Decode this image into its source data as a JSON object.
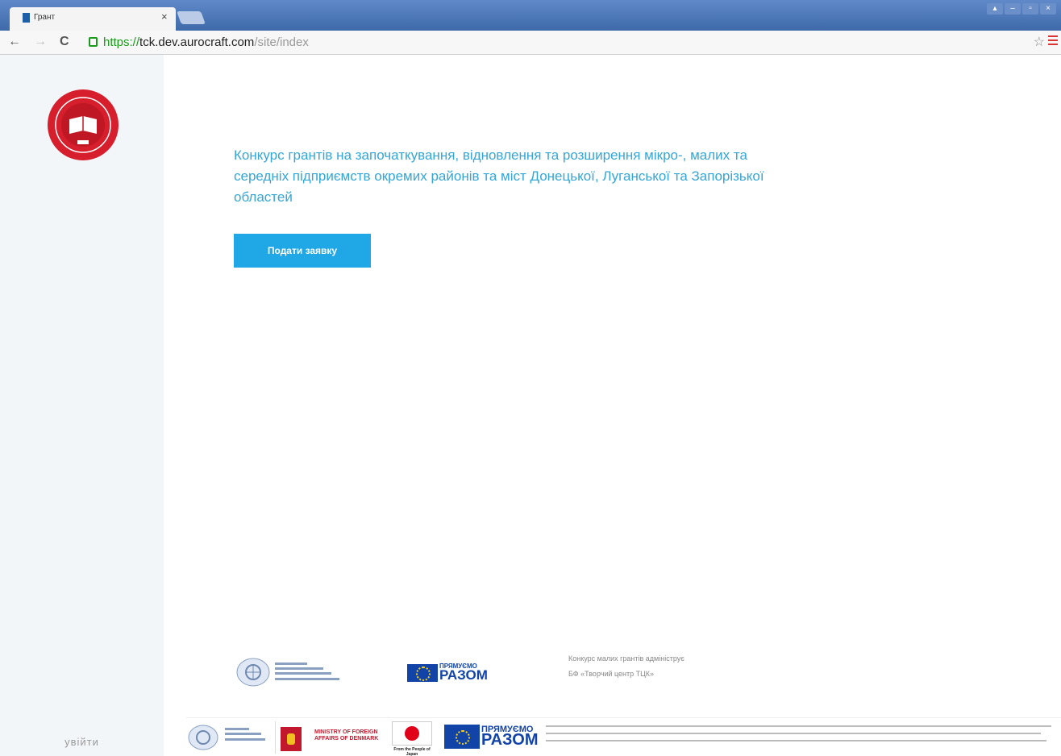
{
  "browser": {
    "tab_title": "Грант",
    "url_scheme": "https://",
    "url_host": "tck.dev.aurocraft.com",
    "url_path": "/site/index"
  },
  "sidebar": {
    "login_label": "увійти"
  },
  "main": {
    "headline": "Конкурс грантів на започаткування, відновлення та розширення мікро-, малих та середніх підприємств окремих районів та міст Донецької, Луганської та Запорізької областей",
    "apply_button": "Подати заявку"
  },
  "footer": {
    "eu_top": "ПРЯМУЄМО",
    "eu_big": "РАЗОМ",
    "description": "Конкурс малих грантів адмініструє БФ «Творчий центр ТЦК»",
    "mfa_text": "MINISTRY OF FOREIGN AFFAIRS OF DENMARK",
    "japan_text": "From the People of Japan"
  },
  "colors": {
    "accent": "#1fa7e6",
    "headline": "#34a6d8",
    "sidebar_bg": "#f3f6f9",
    "logo_red": "#d61e2c"
  }
}
